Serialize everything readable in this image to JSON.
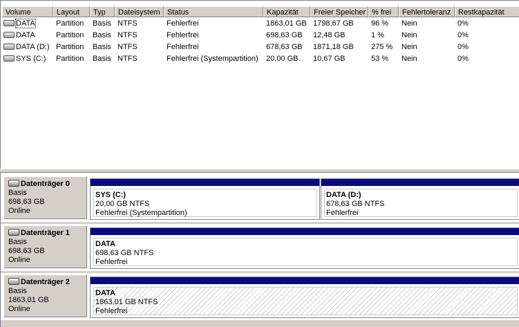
{
  "volume_list": {
    "columns": [
      "Volume",
      "Layout",
      "Typ",
      "Dateisystem",
      "Status",
      "Kapazität",
      "Freier Speicher",
      "% frei",
      "Fehlertoleranz",
      "Restkapazität"
    ],
    "rows": [
      {
        "volume": "DATA",
        "layout": "Partition",
        "typ": "Basis",
        "fs": "NTFS",
        "status": "Fehlerfrei",
        "capacity": "1863,01 GB",
        "free": "1798,67 GB",
        "pct": "96 %",
        "fault": "Nein",
        "overhead": "0%",
        "selected": true
      },
      {
        "volume": "DATA",
        "layout": "Partition",
        "typ": "Basis",
        "fs": "NTFS",
        "status": "Fehlerfrei",
        "capacity": "698,63 GB",
        "free": "12,48 GB",
        "pct": "1 %",
        "fault": "Nein",
        "overhead": "0%"
      },
      {
        "volume": "DATA (D:)",
        "layout": "Partition",
        "typ": "Basis",
        "fs": "NTFS",
        "status": "Fehlerfrei",
        "capacity": "678,63 GB",
        "free": "1871,18 GB",
        "pct": "275 %",
        "fault": "Nein",
        "overhead": "0%"
      },
      {
        "volume": "SYS (C:)",
        "layout": "Partition",
        "typ": "Basis",
        "fs": "NTFS",
        "status": "Fehlerfrei (Systempartition)",
        "capacity": "20,00 GB",
        "free": "10,67 GB",
        "pct": "53 %",
        "fault": "Nein",
        "overhead": "0%"
      }
    ]
  },
  "disks": [
    {
      "title": "Datenträger 0",
      "type": "Basis",
      "size": "698,63 GB",
      "state": "Online",
      "partitions": [
        {
          "name": "SYS  (C:)",
          "size_fs": "20,00 GB NTFS",
          "status": "Fehlerfrei (Systempartition)"
        },
        {
          "name": "DATA  (D:)",
          "size_fs": "678,63 GB NTFS",
          "status": "Fehlerfrei"
        }
      ]
    },
    {
      "title": "Datenträger 1",
      "type": "Basis",
      "size": "698,63 GB",
      "state": "Online",
      "partitions": [
        {
          "name": "DATA",
          "size_fs": "698,63 GB NTFS",
          "status": "Fehlerfrei"
        }
      ]
    },
    {
      "title": "Datenträger 2",
      "type": "Basis",
      "size": "1863,01 GB",
      "state": "Online",
      "partitions": [
        {
          "name": "DATA",
          "size_fs": "1863,01 GB NTFS",
          "status": "Fehlerfrei",
          "selected": true
        }
      ]
    }
  ],
  "colors": {
    "partition_bar": "#0a0a80",
    "panel": "#d4d0c8"
  }
}
